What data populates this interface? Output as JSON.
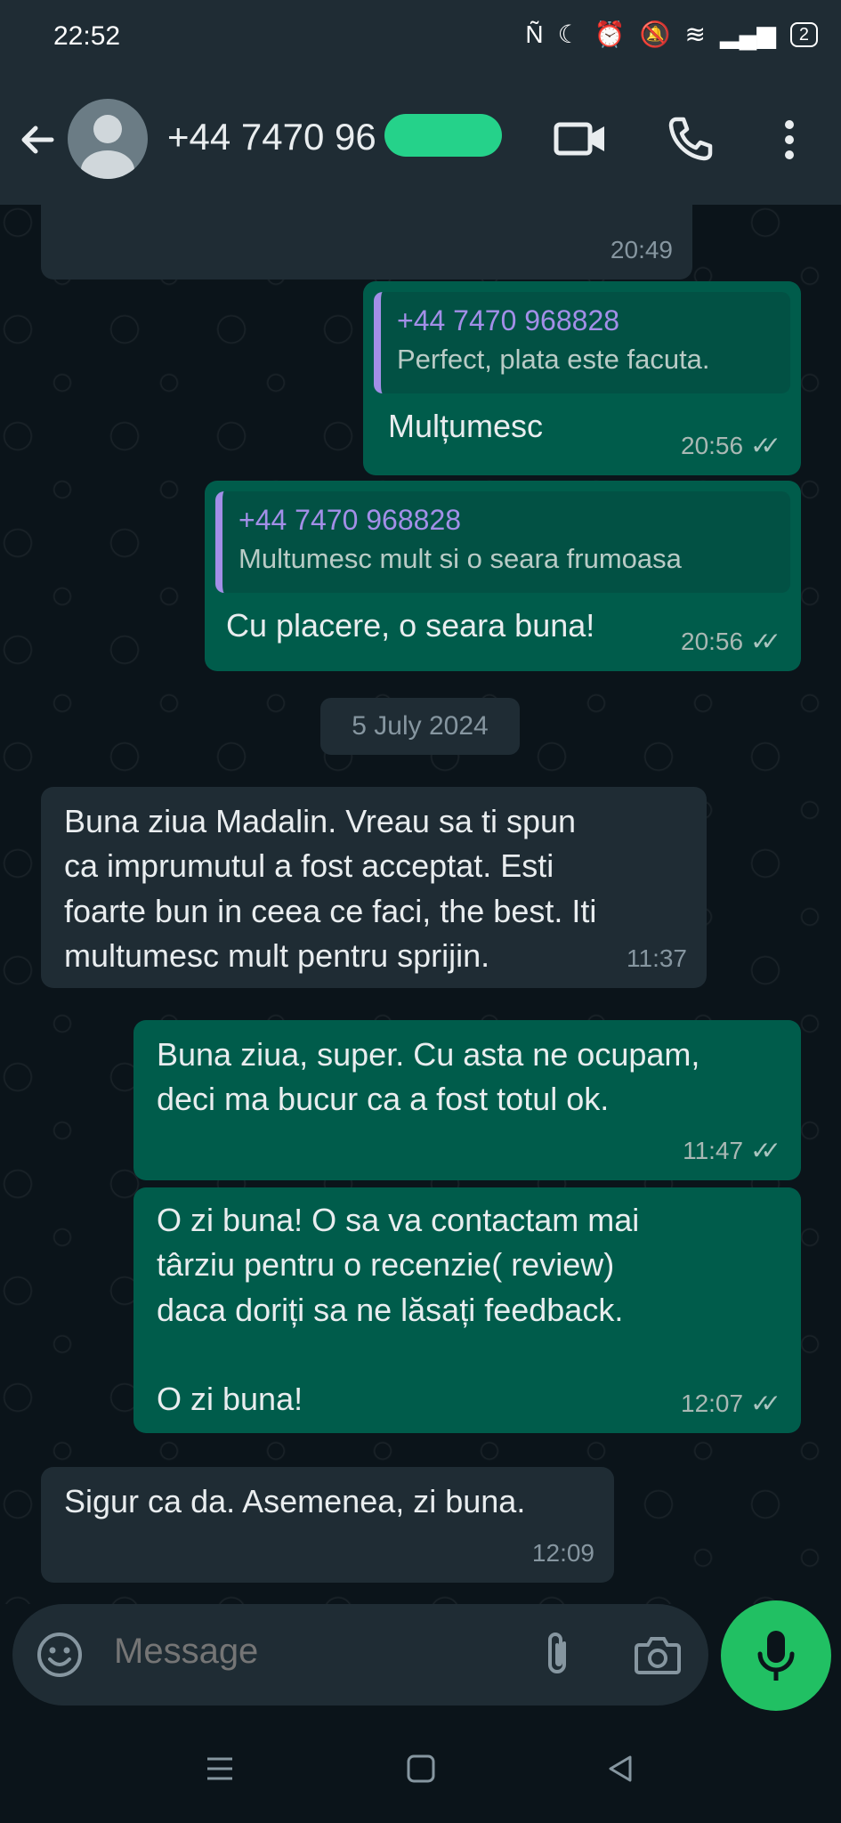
{
  "status_bar": {
    "time": "22:52",
    "battery": "2"
  },
  "header": {
    "contact": "+44 7470 96"
  },
  "messages": [
    {
      "time": "20:49"
    },
    {
      "quote_author": "+44 7470 968828",
      "quote_text": "Perfect, plata este facuta.",
      "text": "Mulțumesc",
      "time": "20:56"
    },
    {
      "quote_author": "+44 7470 968828",
      "quote_text": "Multumesc mult si o seara frumoasa",
      "text": "Cu placere, o seara buna!",
      "time": "20:56"
    },
    {
      "text_lines": [
        "Buna ziua Madalin. Vreau sa ti spun",
        "ca imprumutul a fost acceptat. Esti",
        "foarte bun in ceea ce faci, the best. Iti",
        "multumesc mult pentru sprijin."
      ],
      "time": "11:37"
    },
    {
      "text_lines": [
        "Buna ziua, super. Cu asta ne ocupam,",
        "deci ma bucur ca a fost totul ok."
      ],
      "time": "11:47"
    },
    {
      "text_lines": [
        "O zi buna! O sa va contactam mai",
        "târziu pentru o recenzie( review)",
        "daca doriți sa ne lăsați feedback.",
        "",
        "O zi buna!"
      ],
      "time": "12:07"
    },
    {
      "text": "Sigur ca da. Asemenea, zi buna.",
      "time": "12:09"
    }
  ],
  "date_divider": "5 July 2024",
  "composer": {
    "placeholder": "Message"
  },
  "colors": {
    "incoming": "#1f2c34",
    "outgoing": "#005c4b",
    "accent": "#21c063",
    "quote_author": "#a38fe8"
  },
  "icons": [
    "back-arrow-icon",
    "video-call-icon",
    "phone-icon",
    "more-vertical-icon",
    "emoji-icon",
    "attach-icon",
    "camera-icon",
    "mic-icon"
  ]
}
